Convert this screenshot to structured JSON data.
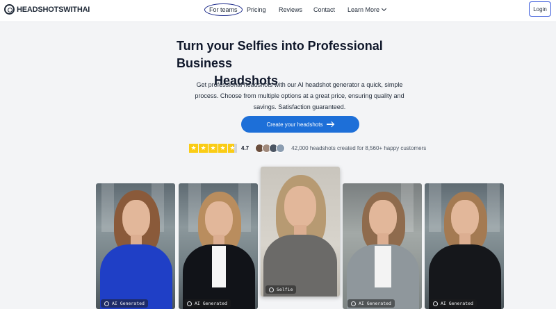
{
  "brand": {
    "name": "HEADSHOTSWITHAI"
  },
  "nav": {
    "links": [
      "For teams",
      "Pricing",
      "Reviews",
      "Contact",
      "Learn More"
    ],
    "login": "Login"
  },
  "hero": {
    "title_line1": "Turn your Selfies into Professional Business",
    "title_line2": "Headshots",
    "subtitle": "Get professional headshots with our AI headshot generator a quick, simple process. Choose from multiple options at a great price, ensuring quality and savings. Satisfaction guaranteed.",
    "cta_label": "Create your headshots"
  },
  "rating": {
    "score": "4.7",
    "stars": 4.7,
    "customers_text": "42,000 headshots created for 8,560+ happy customers"
  },
  "gallery": [
    {
      "label": "AI Generated",
      "outfit": "blue blazer"
    },
    {
      "label": "AI Generated",
      "outfit": "black blazer"
    },
    {
      "label": "Selfie",
      "outfit": "grey sweater"
    },
    {
      "label": "AI Generated",
      "outfit": "grey blazer"
    },
    {
      "label": "AI Generated",
      "outfit": "black top"
    }
  ],
  "colors": {
    "accent": "#1d6fd8",
    "star": "#facc15",
    "background": "#f3f4f6"
  },
  "icons": [
    "logo-icon",
    "chevron-down-icon",
    "arrow-right-icon",
    "star-icon",
    "camera-icon"
  ]
}
